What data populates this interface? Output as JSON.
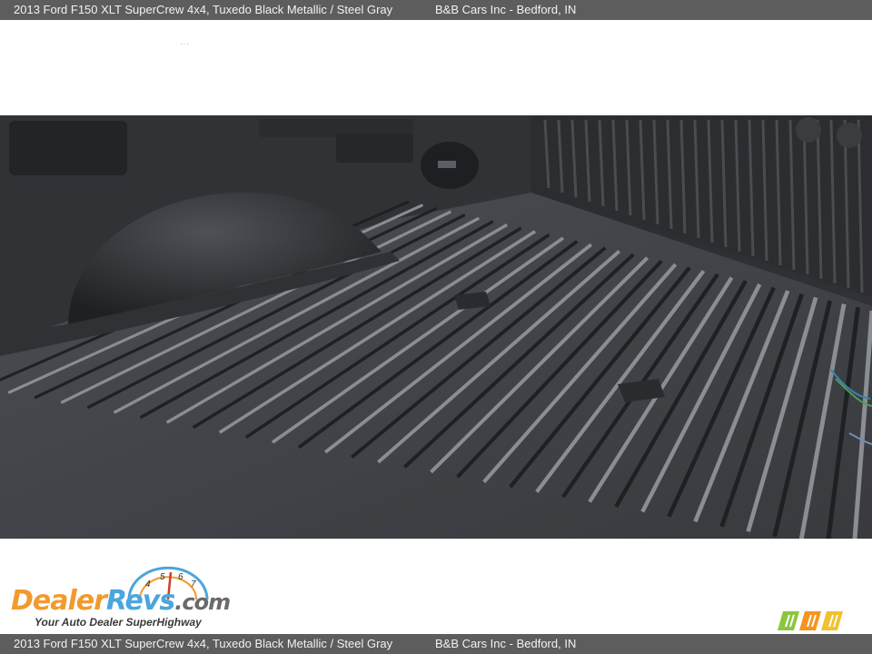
{
  "header": {
    "title": "2013 Ford F150 XLT SuperCrew 4x4,  Tuxedo Black Metallic / Steel Gray",
    "dealer": "B&B Cars Inc - Bedford, IN"
  },
  "footer": {
    "title": "2013 Ford F150 XLT SuperCrew 4x4,  Tuxedo Black Metallic / Steel Gray",
    "dealer": "B&B Cars Inc - Bedford, IN"
  },
  "photo": {
    "subject": "truck-bed-liner",
    "colors": {
      "liner": "#3b3d41",
      "rib_light": "#8a8d92",
      "rib_dark": "#1f2023"
    }
  },
  "logo": {
    "part1": "Dealer",
    "part2": "Revs",
    "part3": ".com",
    "tagline": "Your Auto Dealer SuperHighway",
    "gauge_digits": [
      "4",
      "5",
      "6",
      "7"
    ]
  },
  "colors": {
    "bar_bg": "#5d5d5d",
    "logo_orange": "#f29a2e",
    "logo_blue": "#4aa6dc"
  }
}
